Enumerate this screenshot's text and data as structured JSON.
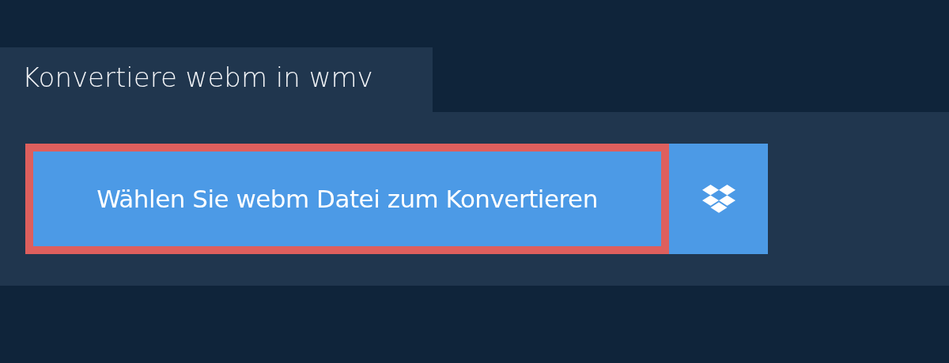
{
  "tab": {
    "title": "Konvertiere webm in wmv"
  },
  "choose_button": {
    "label": "Wählen Sie webm Datei zum Konvertieren",
    "focused": true
  }
}
